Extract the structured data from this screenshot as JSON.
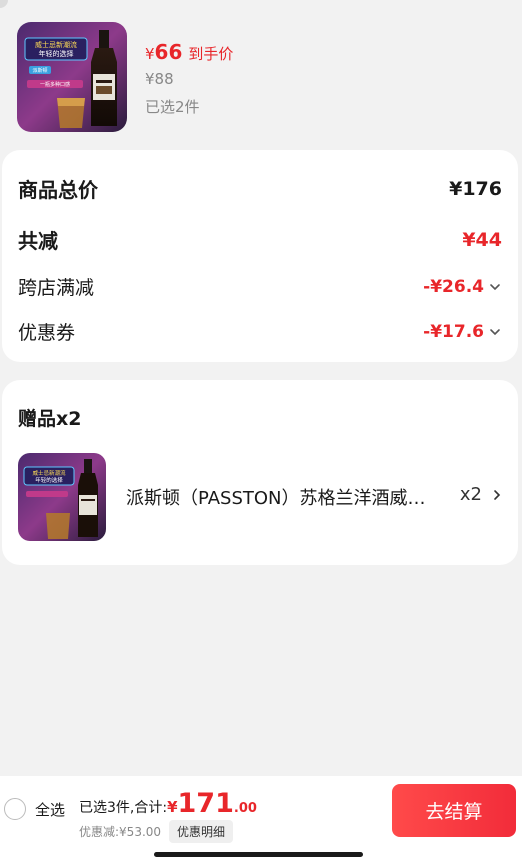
{
  "top_product": {
    "price_yen": "¥",
    "price": "66",
    "price_tag": "到手价",
    "original_price": "¥88",
    "selected": "已选2件",
    "image_text": [
      "威士忌新潮流",
      "年轻的选择",
      "一瓶多种口感",
      "派斯顿"
    ]
  },
  "summary": {
    "total_label": "商品总价",
    "total_value": "¥176",
    "reduce_label": "共减",
    "reduce_value": "¥44",
    "cross_store_label": "跨店满减",
    "cross_store_value": "-¥26.4",
    "coupon_label": "优惠券",
    "coupon_value": "-¥17.6"
  },
  "gift": {
    "title": "赠品x2",
    "name": "派斯顿（PASSTON）苏格兰洋酒威士忌",
    "quantity": "x2",
    "image_text": [
      "威士忌新潮流",
      "年轻的选择"
    ]
  },
  "bottom_bar": {
    "select_all": "全选",
    "total_prefix": "已选3件,合计:",
    "total_yen": "¥",
    "total_int": "171",
    "total_dec": ".00",
    "discount": "优惠减:¥53.00",
    "detail_button": "优惠明细",
    "checkout_button": "去结算"
  },
  "colors": {
    "accent": "#e8262a",
    "background": "#f2f2f2",
    "card": "#ffffff"
  }
}
